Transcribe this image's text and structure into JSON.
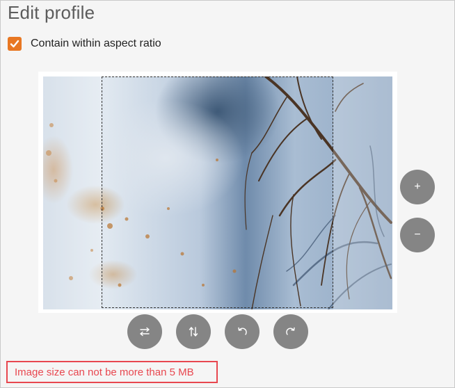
{
  "page": {
    "title": "Edit profile"
  },
  "options": {
    "contain_label": "Contain within aspect ratio",
    "contain_checked": true
  },
  "zoom": {
    "in_label": "+",
    "out_label": "−"
  },
  "toolbar": {
    "flip_horizontal_icon": "flip-horizontal-icon",
    "flip_vertical_icon": "flip-vertical-icon",
    "rotate_left_icon": "rotate-left-icon",
    "rotate_right_icon": "rotate-right-icon"
  },
  "error": {
    "message": "Image size can not be more than 5 MB"
  },
  "colors": {
    "accent": "#e87722",
    "error": "#e8474f",
    "button": "#858585"
  }
}
